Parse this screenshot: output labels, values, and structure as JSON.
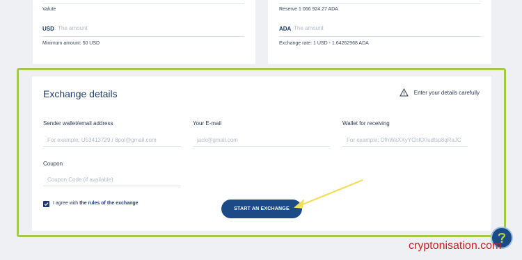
{
  "send": {
    "valute_label": "Valute",
    "currency": "USD",
    "amount_placeholder": "The amount",
    "minimum": "Minimum amount: 50 USD"
  },
  "receive": {
    "reserve": "Reserve 1 066 924.27 ADA",
    "currency": "ADA",
    "amount_placeholder": "The amount",
    "rate": "Exchange rate: 1 USD - 1.64262968 ADA"
  },
  "details": {
    "title": "Exchange details",
    "warning": "Enter your details carefully",
    "sender_label": "Sender wallet/email address",
    "sender_placeholder": "For example: U53413729 / 8pol@gmail.com",
    "email_label": "Your E-mail",
    "email_placeholder": "jack@gmail.com",
    "wallet_label": "Wallet for receiving",
    "wallet_placeholder": "For example: DfhWaXXyYChKXIudtsp8qRaJC",
    "coupon_label": "Coupon",
    "coupon_placeholder": "Coupon Code (if available)",
    "agree_prefix": "I agree with",
    "agree_link": "the rules of the exchange",
    "agree_checked": true,
    "submit": "START AN EXCHANGE"
  },
  "watermark": "cryptonisation.com",
  "colors": {
    "highlight": "#a3c94a",
    "primary": "#1c4a86",
    "arrow": "#f0de5a",
    "watermark": "#d11f1f"
  }
}
